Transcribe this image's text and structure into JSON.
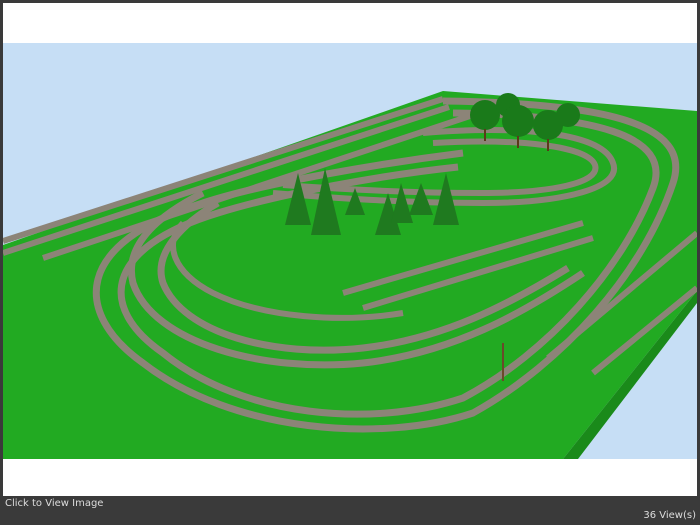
{
  "footer": {
    "click_label": "Click to View Image",
    "views_label": "36 View(s)"
  },
  "colors": {
    "sky": "#c6def5",
    "grass": "#22aa22",
    "grass_dark": "#1a8a1a",
    "track": "#8c8478",
    "trees": "#1f7a1f",
    "chrome": "#3a3a3a"
  }
}
